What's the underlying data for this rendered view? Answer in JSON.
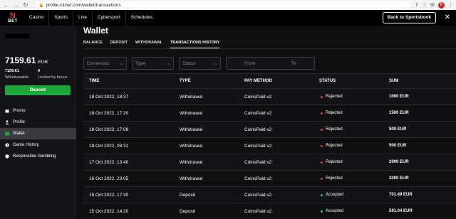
{
  "browser": {
    "url": "profile.n1bet.com/wallet/transactions",
    "profile_initial": "K"
  },
  "topnav": {
    "logo_mark": "N",
    "logo_text": "BET",
    "menu": [
      "Casino",
      "Sports",
      "Live",
      "Cybersport",
      "Schedules"
    ],
    "back_label": "Back to Sportsbook"
  },
  "sidebar": {
    "balance": "7159.61",
    "currency": "EUR",
    "withdrawable_value": "7159.61",
    "withdrawable_label": "Withdrawable",
    "locked_value": "0",
    "locked_label": "Locked by bonus",
    "deposit_label": "Deposit",
    "items": [
      {
        "label": "Promo",
        "icon": "calendar-icon"
      },
      {
        "label": "Profile",
        "icon": "user-icon"
      },
      {
        "label": "Wallet",
        "icon": "wallet-icon"
      },
      {
        "label": "Game History",
        "icon": "history-icon"
      },
      {
        "label": "Responsible Gambling",
        "icon": "shield-icon"
      }
    ],
    "active_item": "Wallet"
  },
  "main": {
    "title": "Wallet",
    "tabs": [
      "BALANCE",
      "DEPOSIT",
      "WITHDRAWAL",
      "TRANSACTIONS HISTORY"
    ],
    "active_tab": "TRANSACTIONS HISTORY",
    "filters": {
      "currencies_placeholder": "Currencies",
      "type_placeholder": "Type",
      "status_placeholder": "Status",
      "from_placeholder": "From",
      "to_placeholder": "To"
    }
  },
  "table": {
    "headers": [
      "TIME",
      "TYPE",
      "PAY METHOD",
      "STATUS",
      "SUM"
    ],
    "rows": [
      {
        "time": "18 Oct 2022, 18:37",
        "type": "Withdrawal",
        "method": "CoinsPaid v2",
        "status": "Rejected",
        "sum": "1000 EUR"
      },
      {
        "time": "18 Oct 2022, 17:20",
        "type": "Withdrawal",
        "method": "CoinsPaid v2",
        "status": "Rejected",
        "sum": "1500 EUR"
      },
      {
        "time": "18 Oct 2022, 17:08",
        "type": "Withdrawal",
        "method": "CoinsPaid v2",
        "status": "Rejected",
        "sum": "500 EUR"
      },
      {
        "time": "18 Oct 2022, 09:31",
        "type": "Withdrawal",
        "method": "CoinsPaid v2",
        "status": "Rejected",
        "sum": "500 EUR"
      },
      {
        "time": "17 Oct 2022, 13:40",
        "type": "Withdrawal",
        "method": "CoinsPaid v2",
        "status": "Rejected",
        "sum": "2000 EUR"
      },
      {
        "time": "16 Oct 2022, 23:05",
        "type": "Withdrawal",
        "method": "CoinsPaid v2",
        "status": "Rejected",
        "sum": "2000 EUR"
      },
      {
        "time": "15 Oct 2022, 17:30",
        "type": "Deposit",
        "method": "CoinsPaid v2",
        "status": "Accepted",
        "sum": "701.49 EUR"
      },
      {
        "time": "15 Oct 2022, 14:20",
        "type": "Deposit",
        "method": "CoinsPaid v2",
        "status": "Accepted",
        "sum": "591.04 EUR"
      }
    ]
  },
  "colors": {
    "rejected": "#e53935",
    "accepted": "#2ecc71",
    "brand_red": "#e53935",
    "deposit_green": "#1fa63a"
  }
}
